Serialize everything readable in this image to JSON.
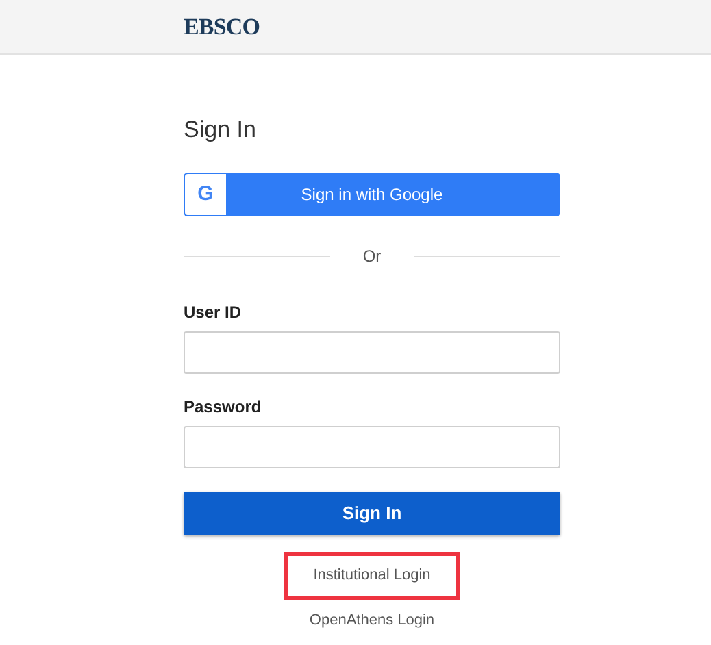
{
  "header": {
    "logo": "EBSCO"
  },
  "form": {
    "title": "Sign In",
    "google_button": {
      "label": "Sign in with Google",
      "icon": "G"
    },
    "divider": "Or",
    "fields": [
      {
        "label": "User ID"
      },
      {
        "label": "Password"
      }
    ],
    "submit": "Sign In",
    "links": [
      {
        "label": "Institutional Login",
        "highlighted": true
      },
      {
        "label": "OpenAthens Login",
        "highlighted": false
      }
    ]
  }
}
